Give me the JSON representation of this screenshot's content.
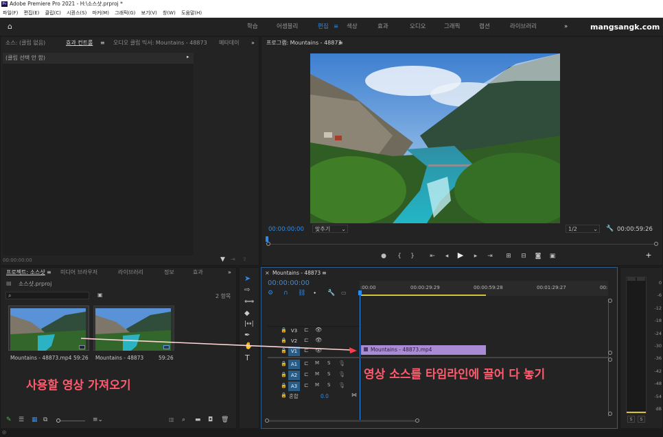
{
  "title": "Adobe Premiere Pro 2021 - H:\\소스샷.prproj *",
  "logo": "Pr",
  "menu": [
    "파일(F)",
    "편집(E)",
    "클립(C)",
    "시퀀스(S)",
    "마커(M)",
    "그래픽(G)",
    "보기(V)",
    "창(W)",
    "도움말(H)"
  ],
  "workspaces": [
    "학습",
    "어셈블리",
    "편집",
    "색상",
    "효과",
    "오디오",
    "그래픽",
    "캡션",
    "라이브러리"
  ],
  "workspace_active": "편집",
  "brand": "mangsangk.com",
  "source_panel": {
    "tabs": [
      "소스: (클립 없음)",
      "효과 컨트롤",
      "오디오 클립 믹서: Mountains - 48873",
      "메타데이"
    ],
    "subheader": "(클립 선택 안 함)",
    "timecode": "00:00:00:00"
  },
  "program": {
    "tab": "프로그램: Mountains - 48873",
    "timecode_left": "00:00:00:00",
    "fit": "맞추기",
    "resolution": "1/2",
    "timecode_right": "00:00:59:26"
  },
  "project": {
    "tabs": [
      "프로젝트: 소스샷",
      "미디어 브라우저",
      "라이브러리",
      "정보",
      "효과"
    ],
    "filename": "소스샷.prproj",
    "count": "2 항목",
    "items": [
      {
        "name": "Mountains - 48873.mp4",
        "duration": "59:26"
      },
      {
        "name": "Mountains - 48873",
        "duration": "59:26"
      }
    ]
  },
  "timeline": {
    "tab": "Mountains - 48873",
    "timecode": "00:00:00:00",
    "ruler": [
      ":00:00",
      "00:00:29:29",
      "00:00:59:28",
      "00:01:29:27",
      "00:"
    ],
    "video_tracks": [
      "V3",
      "V2",
      "V1"
    ],
    "audio_tracks": [
      "A1",
      "A2",
      "A3"
    ],
    "mix_label": "혼합",
    "mix_value": "0.0",
    "clip": "Mountains - 48873.mp4"
  },
  "meter_scale": [
    "0",
    "-6",
    "-12",
    "-18",
    "-24",
    "-30",
    "-36",
    "-42",
    "-48",
    "-54",
    "dB"
  ],
  "annotations": {
    "left": "사용할 영상 가져오기",
    "right": "영상 소스를 타임라인에 끌어 다 놓기"
  },
  "colors": {
    "accent": "#2d8ceb",
    "annotation": "#ff5b6e",
    "clip": "#a98bd5",
    "playhead": "#2d8ceb"
  }
}
